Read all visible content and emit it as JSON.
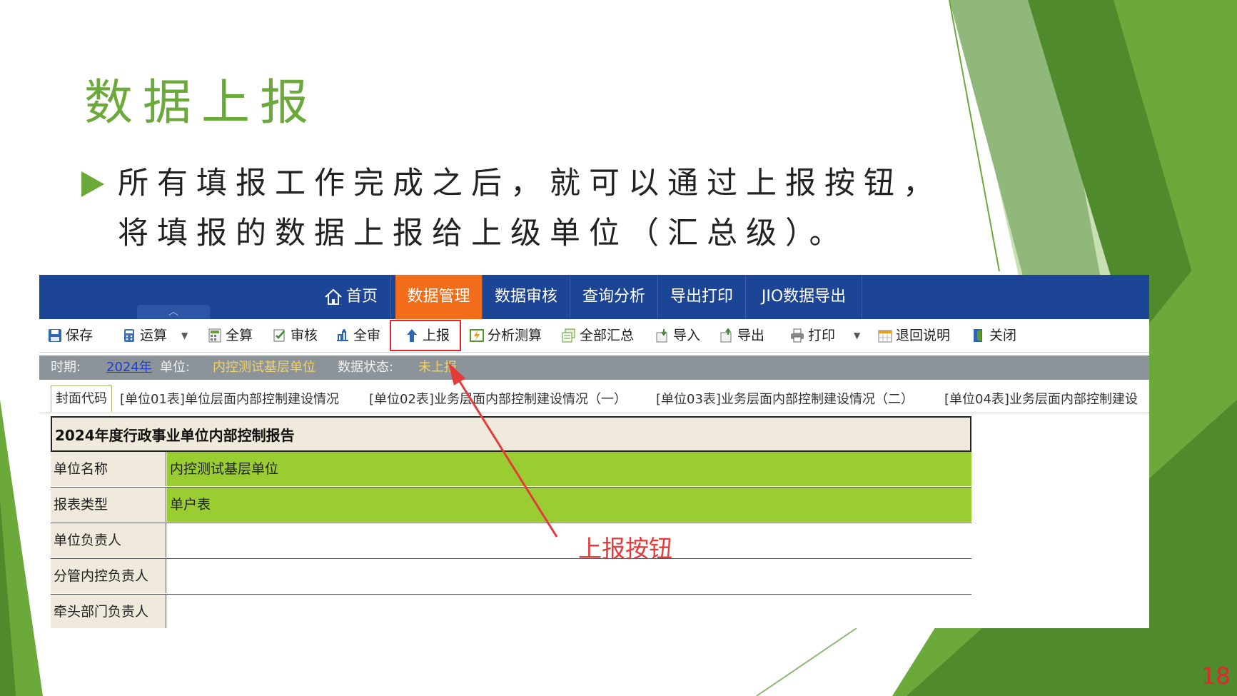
{
  "slide": {
    "title": "数据上报",
    "bullet_line1": "所有填报工作完成之后，就可以通过上报按钮，",
    "bullet_line2": "将填报的数据上报给上级单位（汇总级）。",
    "annotation": "上报按钮",
    "page_number": "18",
    "accent_color": "#6aa93a"
  },
  "nav": {
    "items": [
      {
        "label": "首页",
        "icon": "home-icon"
      },
      {
        "label": "数据管理",
        "active": true
      },
      {
        "label": "数据审核"
      },
      {
        "label": "查询分析"
      },
      {
        "label": "导出打印"
      },
      {
        "label": "JIO数据导出"
      }
    ],
    "handle_glyph": "︿"
  },
  "toolbar": {
    "save": "保存",
    "calc": "运算",
    "calc_all": "全算",
    "audit": "审核",
    "audit_all": "全审",
    "submit": "上报",
    "analysis": "分析测算",
    "summary_all": "全部汇总",
    "import": "导入",
    "export": "导出",
    "print": "打印",
    "return_note": "退回说明",
    "close": "关闭",
    "dropdown_glyph": "▼"
  },
  "status": {
    "period_label": "时期:",
    "period_value": "2024年",
    "unit_label": "单位:",
    "unit_value": "内控测试基层单位",
    "state_label": "数据状态:",
    "state_value": "未上报"
  },
  "tabs": [
    "封面代码",
    "[单位01表]单位层面内部控制建设情况",
    "[单位02表]业务层面内部控制建设情况（一）",
    "[单位03表]业务层面内部控制建设情况（二）",
    "[单位04表]业务层面内部控制建设"
  ],
  "report": {
    "title": "2024年度行政事业单位内部控制报告",
    "rows": [
      {
        "label": "单位名称",
        "value": "内控测试基层单位"
      },
      {
        "label": "报表类型",
        "value": "单户表"
      },
      {
        "label": "单位负责人",
        "value": ""
      },
      {
        "label": "分管内控负责人",
        "value": ""
      },
      {
        "label": "牵头部门负责人",
        "value": ""
      }
    ]
  }
}
